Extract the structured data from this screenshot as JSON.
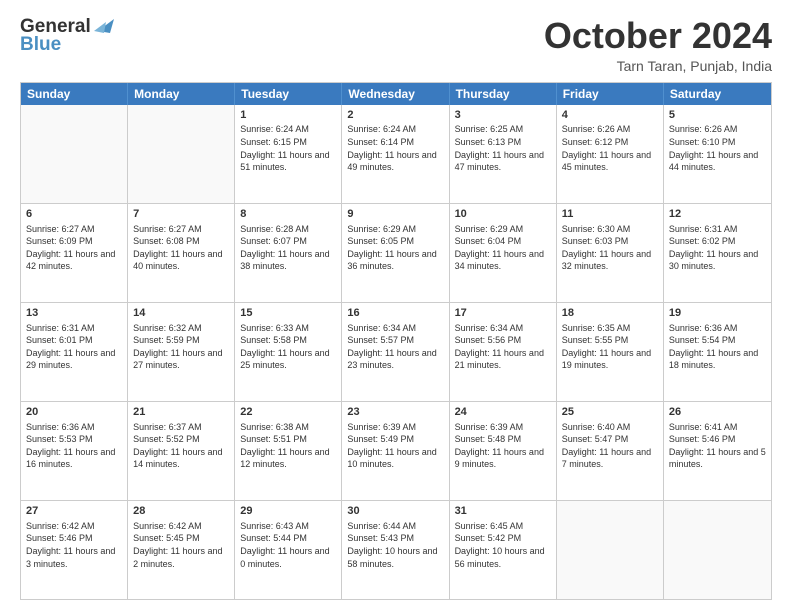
{
  "header": {
    "logo_general": "General",
    "logo_blue": "Blue",
    "month_title": "October 2024",
    "location": "Tarn Taran, Punjab, India"
  },
  "calendar": {
    "days_of_week": [
      "Sunday",
      "Monday",
      "Tuesday",
      "Wednesday",
      "Thursday",
      "Friday",
      "Saturday"
    ],
    "weeks": [
      [
        {
          "day": "",
          "info": ""
        },
        {
          "day": "",
          "info": ""
        },
        {
          "day": "1",
          "info": "Sunrise: 6:24 AM\nSunset: 6:15 PM\nDaylight: 11 hours and 51 minutes."
        },
        {
          "day": "2",
          "info": "Sunrise: 6:24 AM\nSunset: 6:14 PM\nDaylight: 11 hours and 49 minutes."
        },
        {
          "day": "3",
          "info": "Sunrise: 6:25 AM\nSunset: 6:13 PM\nDaylight: 11 hours and 47 minutes."
        },
        {
          "day": "4",
          "info": "Sunrise: 6:26 AM\nSunset: 6:12 PM\nDaylight: 11 hours and 45 minutes."
        },
        {
          "day": "5",
          "info": "Sunrise: 6:26 AM\nSunset: 6:10 PM\nDaylight: 11 hours and 44 minutes."
        }
      ],
      [
        {
          "day": "6",
          "info": "Sunrise: 6:27 AM\nSunset: 6:09 PM\nDaylight: 11 hours and 42 minutes."
        },
        {
          "day": "7",
          "info": "Sunrise: 6:27 AM\nSunset: 6:08 PM\nDaylight: 11 hours and 40 minutes."
        },
        {
          "day": "8",
          "info": "Sunrise: 6:28 AM\nSunset: 6:07 PM\nDaylight: 11 hours and 38 minutes."
        },
        {
          "day": "9",
          "info": "Sunrise: 6:29 AM\nSunset: 6:05 PM\nDaylight: 11 hours and 36 minutes."
        },
        {
          "day": "10",
          "info": "Sunrise: 6:29 AM\nSunset: 6:04 PM\nDaylight: 11 hours and 34 minutes."
        },
        {
          "day": "11",
          "info": "Sunrise: 6:30 AM\nSunset: 6:03 PM\nDaylight: 11 hours and 32 minutes."
        },
        {
          "day": "12",
          "info": "Sunrise: 6:31 AM\nSunset: 6:02 PM\nDaylight: 11 hours and 30 minutes."
        }
      ],
      [
        {
          "day": "13",
          "info": "Sunrise: 6:31 AM\nSunset: 6:01 PM\nDaylight: 11 hours and 29 minutes."
        },
        {
          "day": "14",
          "info": "Sunrise: 6:32 AM\nSunset: 5:59 PM\nDaylight: 11 hours and 27 minutes."
        },
        {
          "day": "15",
          "info": "Sunrise: 6:33 AM\nSunset: 5:58 PM\nDaylight: 11 hours and 25 minutes."
        },
        {
          "day": "16",
          "info": "Sunrise: 6:34 AM\nSunset: 5:57 PM\nDaylight: 11 hours and 23 minutes."
        },
        {
          "day": "17",
          "info": "Sunrise: 6:34 AM\nSunset: 5:56 PM\nDaylight: 11 hours and 21 minutes."
        },
        {
          "day": "18",
          "info": "Sunrise: 6:35 AM\nSunset: 5:55 PM\nDaylight: 11 hours and 19 minutes."
        },
        {
          "day": "19",
          "info": "Sunrise: 6:36 AM\nSunset: 5:54 PM\nDaylight: 11 hours and 18 minutes."
        }
      ],
      [
        {
          "day": "20",
          "info": "Sunrise: 6:36 AM\nSunset: 5:53 PM\nDaylight: 11 hours and 16 minutes."
        },
        {
          "day": "21",
          "info": "Sunrise: 6:37 AM\nSunset: 5:52 PM\nDaylight: 11 hours and 14 minutes."
        },
        {
          "day": "22",
          "info": "Sunrise: 6:38 AM\nSunset: 5:51 PM\nDaylight: 11 hours and 12 minutes."
        },
        {
          "day": "23",
          "info": "Sunrise: 6:39 AM\nSunset: 5:49 PM\nDaylight: 11 hours and 10 minutes."
        },
        {
          "day": "24",
          "info": "Sunrise: 6:39 AM\nSunset: 5:48 PM\nDaylight: 11 hours and 9 minutes."
        },
        {
          "day": "25",
          "info": "Sunrise: 6:40 AM\nSunset: 5:47 PM\nDaylight: 11 hours and 7 minutes."
        },
        {
          "day": "26",
          "info": "Sunrise: 6:41 AM\nSunset: 5:46 PM\nDaylight: 11 hours and 5 minutes."
        }
      ],
      [
        {
          "day": "27",
          "info": "Sunrise: 6:42 AM\nSunset: 5:46 PM\nDaylight: 11 hours and 3 minutes."
        },
        {
          "day": "28",
          "info": "Sunrise: 6:42 AM\nSunset: 5:45 PM\nDaylight: 11 hours and 2 minutes."
        },
        {
          "day": "29",
          "info": "Sunrise: 6:43 AM\nSunset: 5:44 PM\nDaylight: 11 hours and 0 minutes."
        },
        {
          "day": "30",
          "info": "Sunrise: 6:44 AM\nSunset: 5:43 PM\nDaylight: 10 hours and 58 minutes."
        },
        {
          "day": "31",
          "info": "Sunrise: 6:45 AM\nSunset: 5:42 PM\nDaylight: 10 hours and 56 minutes."
        },
        {
          "day": "",
          "info": ""
        },
        {
          "day": "",
          "info": ""
        }
      ]
    ]
  }
}
